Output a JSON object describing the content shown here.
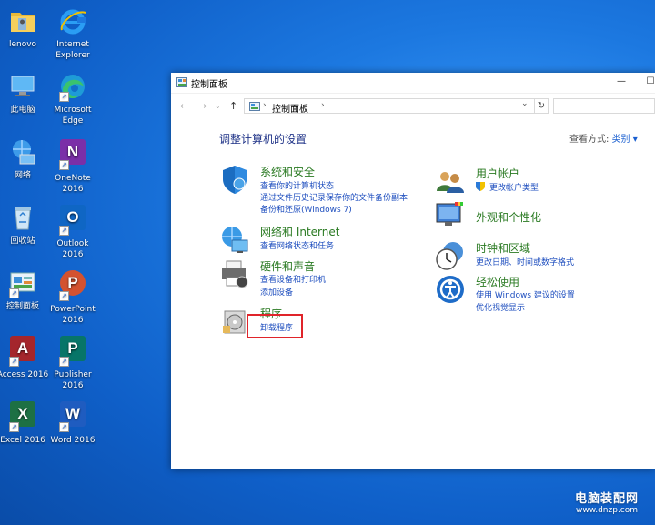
{
  "desktop": {
    "icons": [
      {
        "label": "lenovo"
      },
      {
        "label": "Internet Explorer"
      },
      {
        "label": "此电脑"
      },
      {
        "label": "Microsoft Edge"
      },
      {
        "label": "网络"
      },
      {
        "label": "OneNote 2016"
      },
      {
        "label": "回收站"
      },
      {
        "label": "Outlook 2016"
      },
      {
        "label": "控制面板"
      },
      {
        "label": "PowerPoint 2016"
      },
      {
        "label": "Access 2016"
      },
      {
        "label": "Publisher 2016"
      },
      {
        "label": "Excel 2016"
      },
      {
        "label": "Word 2016"
      }
    ]
  },
  "window": {
    "title": "控制面板",
    "controls": {
      "minimize": "—",
      "maximize": "☐"
    },
    "address": {
      "crumb": "控制面板",
      "chevron": "›",
      "dropdown": "⌄",
      "refresh": "↻"
    },
    "heading": "调整计算机的设置",
    "view_by": {
      "label": "查看方式:",
      "value": "类别 ▾"
    },
    "categories": {
      "security": {
        "title": "系统和安全",
        "links": [
          "查看你的计算机状态",
          "通过文件历史记录保存你的文件备份副本",
          "备份和还原(Windows 7)"
        ]
      },
      "network": {
        "title": "网络和 Internet",
        "links": [
          "查看网络状态和任务"
        ]
      },
      "hardware": {
        "title": "硬件和声音",
        "links": [
          "查看设备和打印机",
          "添加设备"
        ]
      },
      "programs": {
        "title": "程序",
        "links": [
          "卸载程序"
        ]
      },
      "user_accounts": {
        "title": "用户帐户",
        "links": [
          "更改帐户类型"
        ]
      },
      "appearance": {
        "title": "外观和个性化",
        "links": []
      },
      "clock": {
        "title": "时钟和区域",
        "links": [
          "更改日期、时间或数字格式"
        ]
      },
      "ease": {
        "title": "轻松使用",
        "links": [
          "使用 Windows 建议的设置",
          "优化视觉显示"
        ]
      }
    }
  },
  "watermark": {
    "line1": "电脑装配网",
    "line2": "www.dnzp.com"
  },
  "colors": {
    "desktop": "#1c78e0",
    "category_title": "#2a7a22",
    "link": "#1f4fbf",
    "heading": "#1e3287",
    "highlight": "#e0242a"
  }
}
